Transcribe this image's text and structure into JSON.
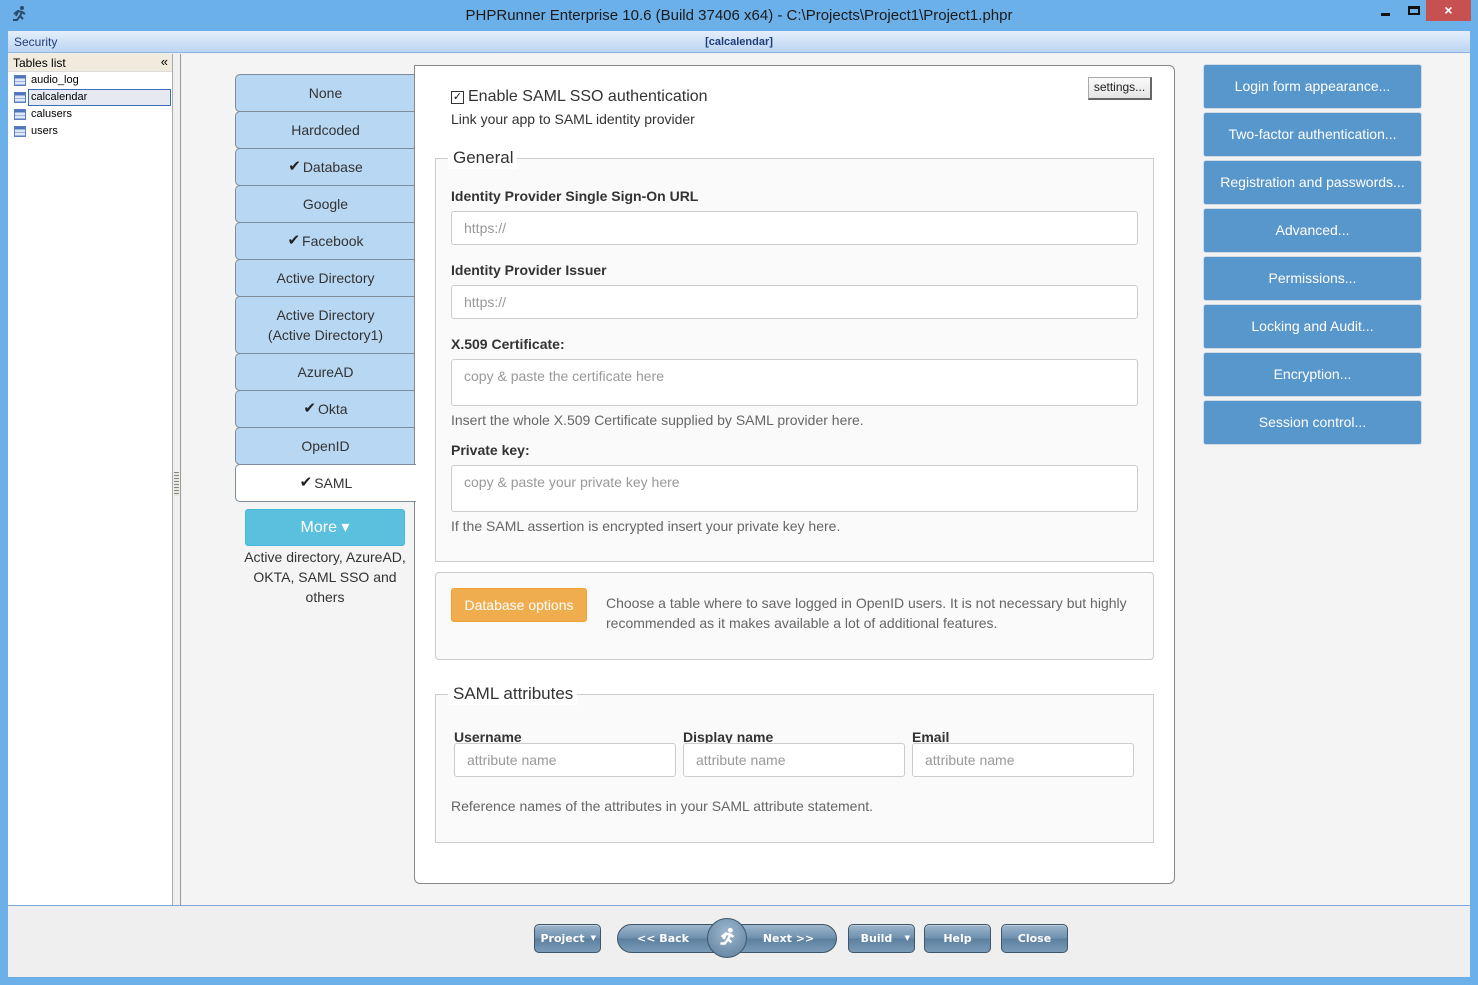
{
  "window": {
    "title": "PHPRunner Enterprise 10.6 (Build 37406 x64) - C:\\Projects\\Project1\\Project1.phpr",
    "app_icon": "running-man-icon",
    "controls": {
      "minimize": "minimize",
      "maximize": "maximize",
      "close": "×"
    }
  },
  "section": {
    "title": "Security",
    "current_table": "[calcalendar]"
  },
  "tables_panel": {
    "header": "Tables list",
    "collapse_glyph": "«",
    "items": [
      {
        "name": "audio_log",
        "selected": false
      },
      {
        "name": "calcalendar",
        "selected": true
      },
      {
        "name": "calusers",
        "selected": false
      },
      {
        "name": "users",
        "selected": false
      }
    ]
  },
  "auth_tabs": [
    {
      "label": "None",
      "checked": false,
      "active": false
    },
    {
      "label": "Hardcoded",
      "checked": false,
      "active": false
    },
    {
      "label": "Database",
      "checked": true,
      "active": false
    },
    {
      "label": "Google",
      "checked": false,
      "active": false
    },
    {
      "label": "Facebook",
      "checked": true,
      "active": false
    },
    {
      "label": "Active Directory",
      "checked": false,
      "active": false
    },
    {
      "label": "Active Directory\n(Active Directory1)",
      "checked": false,
      "active": false
    },
    {
      "label": "AzureAD",
      "checked": false,
      "active": false
    },
    {
      "label": "Okta",
      "checked": true,
      "active": false
    },
    {
      "label": "OpenID",
      "checked": false,
      "active": false
    },
    {
      "label": "SAML",
      "checked": true,
      "active": true
    }
  ],
  "check_glyph": "✔",
  "more": {
    "label": "More ▾",
    "description": "Active directory, AzureAD, OKTA, SAML SSO and others"
  },
  "saml": {
    "settings_label": "settings...",
    "enable_label": "Enable SAML SSO authentication",
    "enable_checked": true,
    "enable_check_glyph": "✓",
    "subtitle": "Link your app to SAML identity provider",
    "general": {
      "legend": "General",
      "sso_url_label": "Identity Provider Single Sign-On URL",
      "sso_url_placeholder": "https://",
      "issuer_label": "Identity Provider Issuer",
      "issuer_placeholder": "https://",
      "cert_label": "X.509 Certificate:",
      "cert_placeholder": "copy & paste the certificate here",
      "cert_help": "Insert the whole X.509 Certificate supplied by SAML provider here.",
      "key_label": "Private key:",
      "key_placeholder": "copy & paste your private key here",
      "key_help": "If the SAML assertion is encrypted insert your private key here."
    },
    "database": {
      "button": "Database options",
      "description": "Choose a table where to save logged in OpenID users. It is not necessary but highly recommended as it makes available a lot of additional features."
    },
    "attributes": {
      "legend": "SAML attributes",
      "username_label": "Username",
      "display_label": "Display name",
      "email_label": "Email",
      "placeholder": "attribute name",
      "help": "Reference names of the attributes in your SAML attribute statement."
    }
  },
  "side_buttons": [
    "Login form appearance...",
    "Two-factor authentication...",
    "Registration and passwords...",
    "Advanced...",
    "Permissions...",
    "Locking and Audit...",
    "Encryption...",
    "Session control..."
  ],
  "bottom": {
    "project": "Project",
    "back": "<< Back",
    "next": "Next >>",
    "run_icon": "running-man-icon",
    "build": "Build",
    "help": "Help",
    "close": "Close",
    "caret": "▼"
  },
  "colors": {
    "title_bar": "#6cb0ea",
    "tab_bg": "#b7d7f3",
    "side_button": "#5897cb",
    "more_button": "#5bc0de",
    "db_button": "#f0ad4e",
    "close_button": "#c75050"
  }
}
